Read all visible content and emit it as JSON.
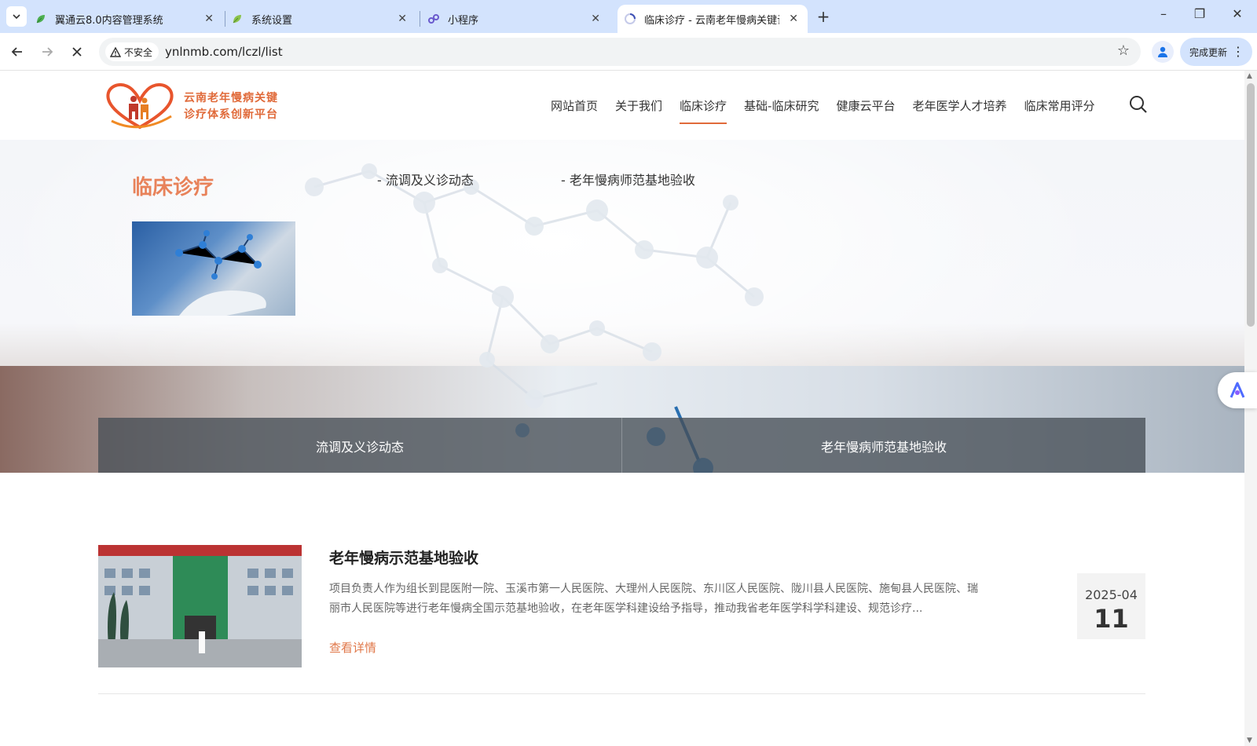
{
  "browser": {
    "tabs": [
      {
        "title": "翼通云8.0内容管理系统",
        "icon": "leaf-icon"
      },
      {
        "title": "系统设置",
        "icon": "leaf-icon"
      },
      {
        "title": "小程序",
        "icon": "miniprogram-icon"
      },
      {
        "title": "临床诊疗 - 云南老年慢病关键诊",
        "icon": "loading-icon"
      }
    ],
    "security_label": "不安全",
    "url": "ynlnmb.com/lczl/list",
    "update_label": "完成更新"
  },
  "site": {
    "logo_line1": "云南老年慢病关键",
    "logo_line2": "诊疗体系创新平台",
    "nav": [
      "网站首页",
      "关于我们",
      "临床诊疗",
      "基础-临床研究",
      "健康云平台",
      "老年医学人才培养",
      "临床常用评分"
    ],
    "active_nav": "临床诊疗"
  },
  "hero": {
    "title": "临床诊疗",
    "links": [
      "- 流调及义诊动态",
      "- 老年慢病师范基地验收"
    ],
    "subnav": [
      "流调及义诊动态",
      "老年慢病师范基地验收"
    ]
  },
  "articles": [
    {
      "title": "老年慢病示范基地验收",
      "description": "项目负责人作为组长到昆医附一院、玉溪市第一人民医院、大理州人民医院、东川区人民医院、陇川县人民医院、施甸县人民医院、瑞丽市人民医院等进行老年慢病全国示范基地验收，在老年医学科建设给予指导，推动我省老年医学科学科建设、规范诊疗...",
      "more_label": "查看详情",
      "date_ym": "2025-04",
      "date_day": "11"
    }
  ],
  "colors": {
    "accent": "#e06a3a",
    "tab_strip": "#d3e3fd"
  }
}
